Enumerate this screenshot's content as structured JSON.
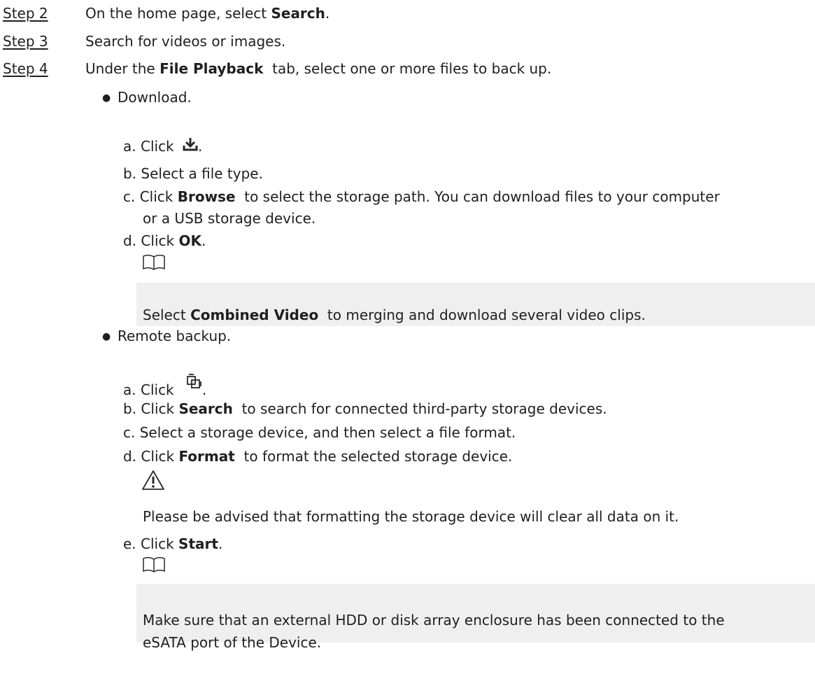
{
  "steps": [
    {
      "label": "Step 2",
      "text_pre": "On the home page, select ",
      "bold": "Search",
      "text_post": "."
    },
    {
      "label": "Step 3",
      "text": "Search for videos or images."
    },
    {
      "label": "Step 4",
      "text_pre": "Under the ",
      "bold": "File Playback",
      "text_post": "  tab, select one or more files to back up."
    }
  ],
  "download": {
    "title": "Download.",
    "a": {
      "marker": "a.",
      "text": "Click",
      "icon": "download-icon",
      "after": "."
    },
    "b": {
      "marker": "b.",
      "text": "Select a file type."
    },
    "c": {
      "marker": "c.",
      "pre": "Click ",
      "bold": "Browse",
      "post1": "  to select the storage path. You can download files to your computer",
      "post2": "or a USB storage device."
    },
    "d": {
      "marker": "d.",
      "pre": "Click ",
      "bold": "OK",
      "post": "."
    },
    "note": {
      "icon": "note-book-icon",
      "pre": "Select ",
      "bold": "Combined Video",
      "post": "  to merging and download several video clips."
    }
  },
  "remote": {
    "title": "Remote backup.",
    "a": {
      "marker": "a.",
      "text": "Click",
      "icon": "remote-backup-icon",
      "after": "."
    },
    "b": {
      "marker": "b.",
      "pre": "Click ",
      "bold": "Search",
      "post": "  to search for connected third-party storage devices."
    },
    "c": {
      "marker": "c.",
      "text": "Select a storage device, and then select a file format."
    },
    "d": {
      "marker": "d.",
      "pre": "Click ",
      "bold": "Format",
      "post": "  to format the selected storage device."
    },
    "warning": {
      "icon": "warning-icon",
      "text": "Please be advised that formatting the storage device will clear all data on it."
    },
    "e": {
      "marker": "e.",
      "pre": "Click ",
      "bold": "Start",
      "post": "."
    },
    "note": {
      "icon": "note-book-icon",
      "line1": "Make sure that an external HDD or disk array enclosure has been connected to the",
      "line2": "eSATA port of the Device."
    }
  }
}
